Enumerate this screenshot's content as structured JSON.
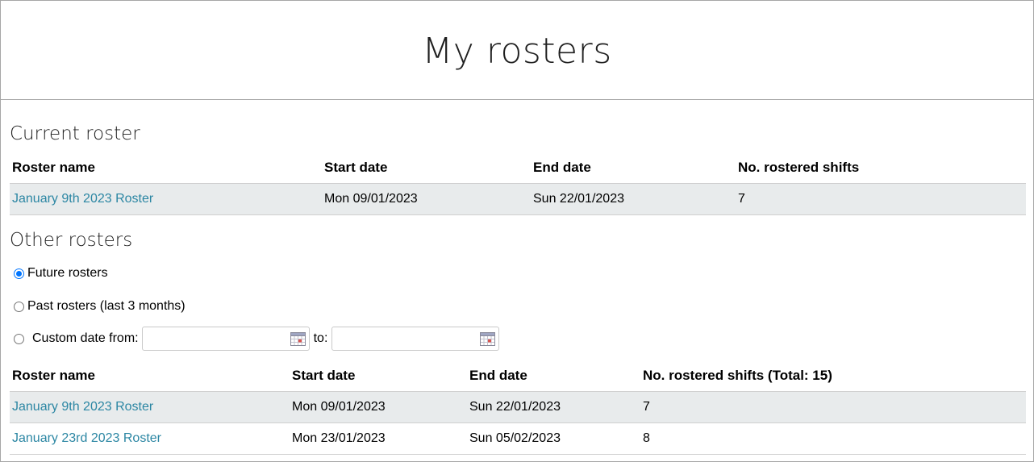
{
  "header": {
    "title": "My rosters"
  },
  "current": {
    "title": "Current roster",
    "columns": [
      "Roster name",
      "Start date",
      "End date",
      "No. rostered shifts"
    ],
    "rows": [
      {
        "name": "January 9th 2023 Roster",
        "start": "Mon 09/01/2023",
        "end": "Sun 22/01/2023",
        "shifts": "7"
      }
    ]
  },
  "other": {
    "title": "Other rosters",
    "filters": {
      "future_label": "Future rosters",
      "past_label": "Past rosters (last 3 months)",
      "custom_label": "Custom date from:",
      "to_label": "to:",
      "selected": "future",
      "from_value": "",
      "to_value": ""
    },
    "columns": [
      "Roster name",
      "Start date",
      "End date",
      "No. rostered shifts (Total: 15)"
    ],
    "rows": [
      {
        "name": "January 9th 2023 Roster",
        "start": "Mon 09/01/2023",
        "end": "Sun 22/01/2023",
        "shifts": "7"
      },
      {
        "name": "January 23rd 2023 Roster",
        "start": "Mon 23/01/2023",
        "end": "Sun 05/02/2023",
        "shifts": "8"
      }
    ]
  },
  "icons": {
    "calendar": "calendar-icon"
  },
  "colors": {
    "link": "#2b86a3",
    "row_shade": "#e8ebec",
    "radio_accent": "#0075ff"
  }
}
